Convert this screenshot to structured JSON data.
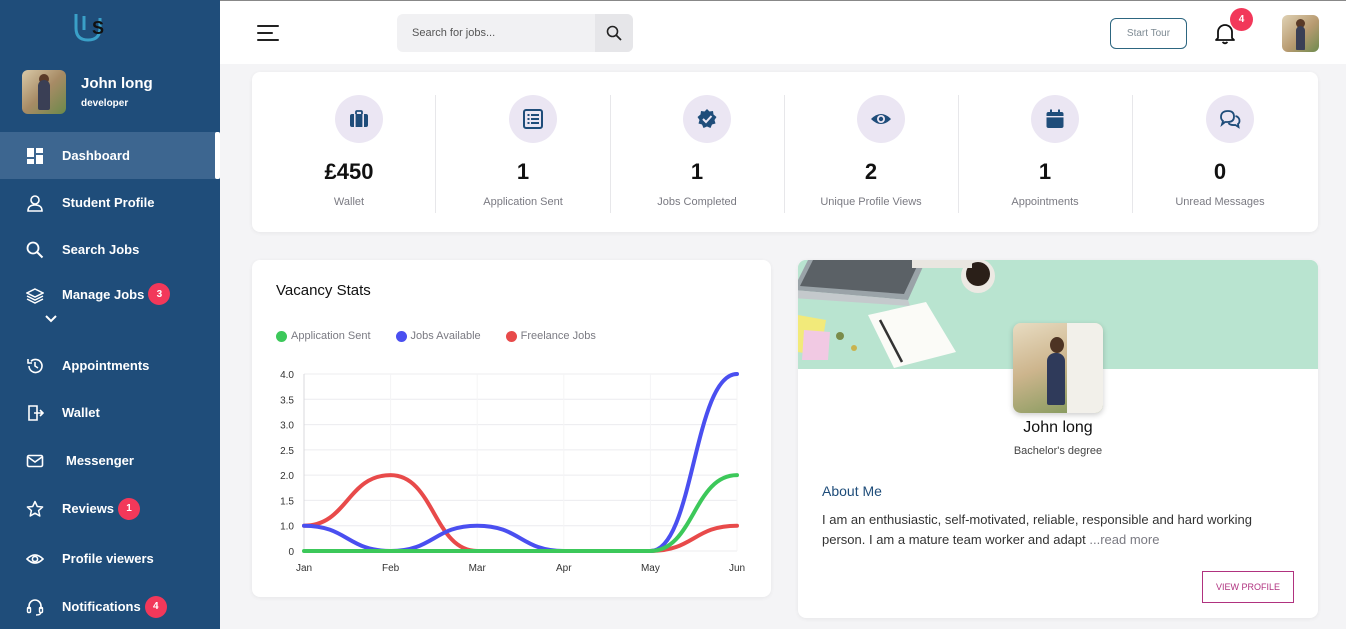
{
  "sidebar": {
    "user": {
      "name": "John long",
      "role": "developer"
    },
    "items": [
      {
        "label": "Dashboard",
        "icon": "dashboard-icon",
        "badge": ""
      },
      {
        "label": "Student Profile",
        "icon": "user-icon",
        "badge": ""
      },
      {
        "label": "Search Jobs",
        "icon": "search-icon",
        "badge": ""
      },
      {
        "label": "Manage Jobs",
        "icon": "layers-icon",
        "badge": "3"
      },
      {
        "label": "Appointments",
        "icon": "history-icon",
        "badge": ""
      },
      {
        "label": "Wallet",
        "icon": "wallet-icon",
        "badge": ""
      },
      {
        "label": "Messenger",
        "icon": "mail-icon",
        "badge": ""
      },
      {
        "label": "Reviews",
        "icon": "star-icon",
        "badge": "1"
      },
      {
        "label": "Profile viewers",
        "icon": "eye-icon",
        "badge": ""
      },
      {
        "label": "Notifications",
        "icon": "headset-icon",
        "badge": "4"
      }
    ]
  },
  "topbar": {
    "search_placeholder": "Search for jobs...",
    "tour_label": "Start Tour",
    "notification_count": "4"
  },
  "stats": [
    {
      "value": "£450",
      "label": "Wallet",
      "icon": "briefcase-icon"
    },
    {
      "value": "1",
      "label": "Application Sent",
      "icon": "list-icon"
    },
    {
      "value": "1",
      "label": "Jobs Completed",
      "icon": "badge-check-icon"
    },
    {
      "value": "2",
      "label": "Unique Profile Views",
      "icon": "eye-icon"
    },
    {
      "value": "1",
      "label": "Appointments",
      "icon": "calendar-icon"
    },
    {
      "value": "0",
      "label": "Unread Messages",
      "icon": "chat-icon"
    }
  ],
  "chart_data": {
    "type": "line",
    "title": "Vacancy Stats",
    "categories": [
      "Jan",
      "Feb",
      "Mar",
      "Apr",
      "May",
      "Jun"
    ],
    "ylim": [
      0,
      4
    ],
    "yticks": [
      "0",
      "1.0",
      "1.5",
      "2.0",
      "2.5",
      "3.0",
      "3.5",
      "4.0"
    ],
    "grid": true,
    "legend_position": "top-left",
    "series": [
      {
        "name": "Application Sent",
        "color": "#3cc85a",
        "values": [
          0,
          0,
          0,
          0,
          0,
          2
        ]
      },
      {
        "name": "Jobs Available",
        "color": "#4a4ff0",
        "values": [
          1,
          0,
          1,
          0,
          0,
          4
        ]
      },
      {
        "name": "Freelance Jobs",
        "color": "#e84a4a",
        "values": [
          1,
          2,
          0,
          0,
          0,
          1
        ]
      }
    ]
  },
  "profile": {
    "name": "John long",
    "degree": "Bachelor's degree",
    "about_title": "About Me",
    "about_text": "I am an enthusiastic, self-motivated, reliable, responsible and hard working person. I am a mature team worker and adapt ",
    "read_more": "...read more",
    "view_button": "VIEW PROFILE"
  }
}
